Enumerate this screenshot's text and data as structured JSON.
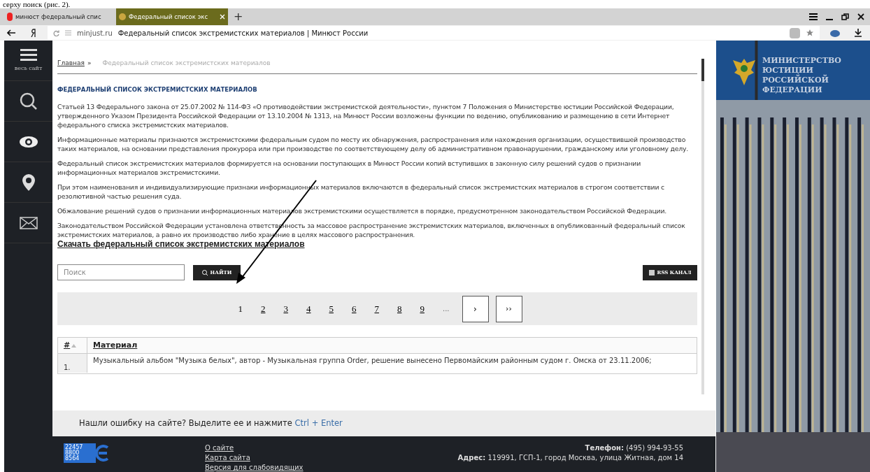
{
  "document_text": "серху поиск (рис. 2).",
  "tabs": [
    {
      "label": "минюст федеральный спис",
      "selected": false,
      "kind": "search"
    },
    {
      "label": "Федеральный список экс",
      "selected": true,
      "kind": "site"
    }
  ],
  "new_tab": "+",
  "address": {
    "domain": "minjust.ru",
    "title": "Федеральный список экстремистских материалов | Минюст России"
  },
  "sidebar": {
    "menu_label": "весь сайт"
  },
  "breadcrumb": {
    "home": "Главная",
    "separator": "»",
    "current": "Федеральный список экстремистских материалов"
  },
  "heading": "ФЕДЕРАЛЬНЫЙ СПИСОК ЭКСТРЕМИСТСКИХ МАТЕРИАЛОВ",
  "paragraphs": [
    "Статьей 13 Федерального закона от 25.07.2002 № 114-ФЗ «О противодействии экстремистской деятельности», пунктом 7 Положения о Министерстве юстиции Российской Федерации, утвержденного Указом Президента Российской Федерации от 13.10.2004 № 1313, на Минюст России возложены функции по ведению, опубликованию и размещению в сети Интернет федерального списка экстремистских материалов.",
    "Информационные материалы признаются экстремистскими федеральным судом по месту их обнаружения, распространения или нахождения организации, осуществившей производство таких материалов, на основании представления прокурора или при производстве по соответствующему делу об административном правонарушении, гражданскому или уголовному делу.",
    "Федеральный список экстремистских материалов формируется на основании поступающих в Минюст России копий вступивших в законную силу решений судов о признании информационных материалов экстремистскими.",
    "При этом наименования и индивидуализирующие признаки информационных материалов включаются в федеральный список экстремистских материалов в строгом соответствии с резолютивной частью решения суда.",
    "Обжалование решений судов о признании информационных материалов экстремистскими осуществляется в порядке, предусмотренном законодательством Российской Федерации.",
    "Законодательством Российской Федерации установлена ответственность за массовое распространение экстремистских материалов, включенных в опубликованный федеральный список экстремистских материалов, а равно их производство либо хранение в целях массового распространения."
  ],
  "download_link": "Скачать федеральный список экстремистских материалов",
  "search": {
    "placeholder": "Поиск",
    "button": "НАЙТИ"
  },
  "rss_button": "RSS КАНАЛ",
  "pagination": {
    "pages": [
      {
        "label": "1",
        "selected": true
      },
      {
        "label": "2",
        "selected": false
      },
      {
        "label": "3",
        "selected": false
      },
      {
        "label": "4",
        "selected": false
      },
      {
        "label": "5",
        "selected": false
      },
      {
        "label": "6",
        "selected": false
      },
      {
        "label": "7",
        "selected": false
      },
      {
        "label": "8",
        "selected": false
      },
      {
        "label": "9",
        "selected": false
      }
    ],
    "ellipsis": "...",
    "next": "›",
    "last": "››"
  },
  "table": {
    "columns": [
      "#",
      "Материал"
    ],
    "rows": [
      {
        "number": "1.",
        "material": "Музыкальный альбом \"Музыка белых\", автор - Музыкальная группа Order, решение вынесено Первомайским районным судом г. Омска от 23.11.2006;"
      }
    ]
  },
  "error_notice": {
    "text": "Нашли ошибку на сайте? Выделите ее и нажмите",
    "keys": "Ctrl + Enter"
  },
  "footer": {
    "counter": [
      "22457",
      "8800",
      "8564"
    ],
    "links": [
      "О сайте",
      "Карта сайта",
      "Версия для слабовидящих"
    ],
    "phone_label": "Телефон:",
    "phone": "(495) 994-93-55",
    "address_label": "Адрес:",
    "address": "119991, ГСП-1, город Москва, улица Житная, дом 14"
  },
  "banner": {
    "lines": [
      "МИНИСТЕРСТВО",
      "ЮСТИЦИИ",
      "РОССИЙСКОЙ",
      "ФЕДЕРАЦИИ"
    ]
  }
}
